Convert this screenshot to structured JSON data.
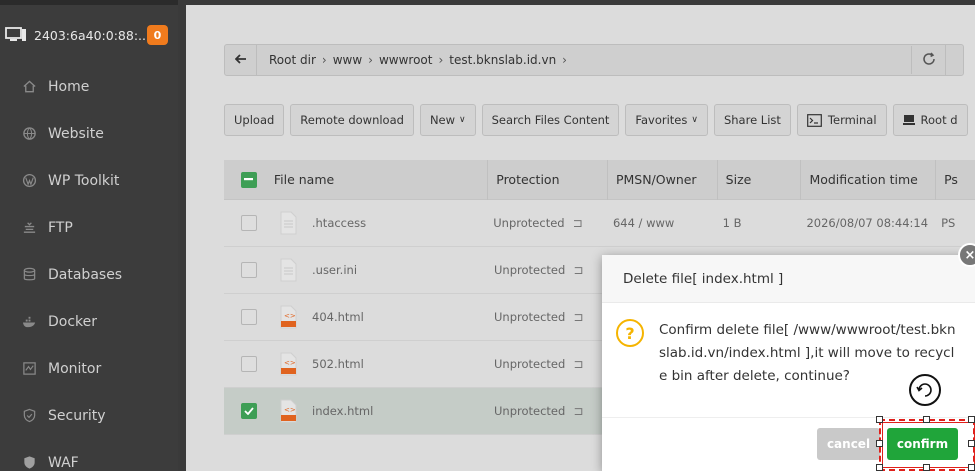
{
  "server": {
    "ip": "2403:6a40:0:88:...",
    "badge": "0"
  },
  "sidebar": {
    "items": [
      {
        "label": "Home",
        "icon": "home-icon"
      },
      {
        "label": "Website",
        "icon": "globe-icon"
      },
      {
        "label": "WP Toolkit",
        "icon": "wordpress-icon"
      },
      {
        "label": "FTP",
        "icon": "ftp-icon"
      },
      {
        "label": "Databases",
        "icon": "database-icon"
      },
      {
        "label": "Docker",
        "icon": "docker-icon"
      },
      {
        "label": "Monitor",
        "icon": "monitor-icon"
      },
      {
        "label": "Security",
        "icon": "shield-icon"
      },
      {
        "label": "WAF",
        "icon": "waf-shield-icon"
      }
    ]
  },
  "path": {
    "crumbs": [
      "Root dir",
      "www",
      "wwwroot",
      "test.bknslab.id.vn"
    ]
  },
  "toolbar": {
    "upload": "Upload",
    "remote_download": "Remote download",
    "new": "New",
    "search": "Search Files Content",
    "favorites": "Favorites",
    "share_list": "Share List",
    "terminal": "Terminal",
    "root": "Root d"
  },
  "table": {
    "headers": {
      "name": "File name",
      "protection": "Protection",
      "owner": "PMSN/Owner",
      "size": "Size",
      "modified": "Modification time",
      "ps": "Ps"
    },
    "rows": [
      {
        "name": ".htaccess",
        "protection": "Unprotected",
        "owner": "644 / www",
        "size": "1 B",
        "modified": "2026/08/07 08:44:14",
        "ps": "PS",
        "type": "text",
        "checked": false
      },
      {
        "name": ".user.ini",
        "protection": "Unprotected",
        "owner": "",
        "size": "",
        "modified": "",
        "ps": "",
        "type": "text",
        "checked": false
      },
      {
        "name": "404.html",
        "protection": "Unprotected",
        "owner": "",
        "size": "",
        "modified": "",
        "ps": "",
        "type": "html",
        "checked": false
      },
      {
        "name": "502.html",
        "protection": "Unprotected",
        "owner": "",
        "size": "",
        "modified": "",
        "ps": "",
        "type": "html",
        "checked": false
      },
      {
        "name": "index.html",
        "protection": "Unprotected",
        "owner": "",
        "size": "",
        "modified": "",
        "ps": "",
        "type": "html",
        "checked": true
      }
    ]
  },
  "dialog": {
    "title": "Delete file[ index.html ]",
    "message": "Confirm delete file[ /www/wwwroot/test.bknslab.id.vn/index.html ],it will move to recycle bin after delete, continue?",
    "cancel": "cancel",
    "confirm": "confirm"
  },
  "colors": {
    "accent": "#20a53a",
    "badge": "#f07b1d",
    "highlight": "#e0201b",
    "warning": "#f5b400"
  }
}
